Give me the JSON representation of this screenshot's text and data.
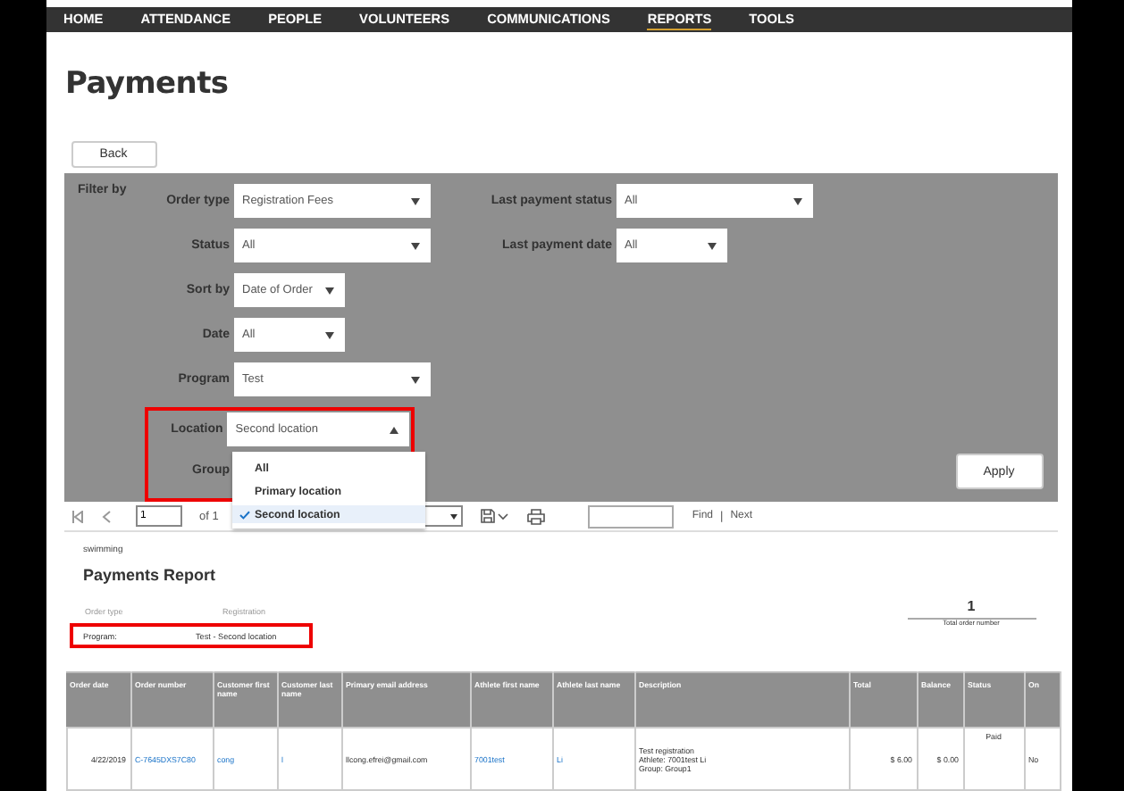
{
  "nav": [
    {
      "label": "HOME",
      "selected": false
    },
    {
      "label": "ATTENDANCE",
      "selected": false
    },
    {
      "label": "PEOPLE",
      "selected": false
    },
    {
      "label": "VOLUNTEERS",
      "selected": false
    },
    {
      "label": "COMMUNICATIONS",
      "selected": false
    },
    {
      "label": "REPORTS",
      "selected": true
    },
    {
      "label": "TOOLS",
      "selected": false
    }
  ],
  "page_title": "Payments",
  "back_button": "Back",
  "filter": {
    "heading": "Filter by",
    "left": [
      {
        "label": "Order type",
        "value": "Registration Fees",
        "kind": "wide"
      },
      {
        "label": "Status",
        "value": "All",
        "kind": "wide"
      },
      {
        "label": "Sort by",
        "value": "Date of Order",
        "kind": "narrow"
      },
      {
        "label": "Date",
        "value": "All",
        "kind": "narrow"
      },
      {
        "label": "Program",
        "value": "Test",
        "kind": "wide"
      }
    ],
    "location": {
      "label": "Location",
      "value": "Second location",
      "expanded": true,
      "options": [
        {
          "label": "All",
          "selected": false
        },
        {
          "label": "Primary location",
          "selected": false
        },
        {
          "label": "Second location",
          "selected": true
        }
      ]
    },
    "group_label": "Group",
    "right": [
      {
        "label": "Last payment status",
        "value": "All",
        "kind": "wide"
      },
      {
        "label": "Last payment date",
        "value": "All",
        "kind": "narrow"
      }
    ],
    "apply_button": "Apply"
  },
  "toolbar": {
    "page": "1",
    "of": "of 1",
    "find": "Find",
    "separator": "|",
    "next": "Next"
  },
  "report": {
    "org": "swimming",
    "title": "Payments Report",
    "meta_labels": [
      "Order type",
      "Registration"
    ],
    "program_label": "Program:",
    "program_value": "Test - Second location",
    "total": "1",
    "total_label": "Total order number",
    "table": {
      "columns": [
        "Order date",
        "Order number",
        "Customer first name",
        "Customer last name",
        "Primary email address",
        "Athlete first name",
        "Athlete last name",
        "Description",
        "Total",
        "Balance",
        "Status",
        "On"
      ],
      "rows": [
        [
          {
            "text": "4/22/2019",
            "kind": "right"
          },
          {
            "text": "C-7645DXS7C80",
            "kind": "link"
          },
          {
            "text": "cong",
            "kind": "link"
          },
          {
            "text": "l",
            "kind": "link"
          },
          {
            "text": "llcong.efrei@gmail.com",
            "kind": "plain"
          },
          {
            "text": "7001test",
            "kind": "link"
          },
          {
            "text": "Li",
            "kind": "link"
          },
          {
            "text": "Test registration\nAthlete: 7001test Li\nGroup: Group1",
            "kind": "plain"
          },
          {
            "text": "$ 6.00",
            "kind": "right"
          },
          {
            "text": "$ 0.00",
            "kind": "right"
          },
          {
            "text": "Paid",
            "kind": "top"
          },
          {
            "text": "No",
            "kind": "plain"
          }
        ]
      ]
    }
  }
}
